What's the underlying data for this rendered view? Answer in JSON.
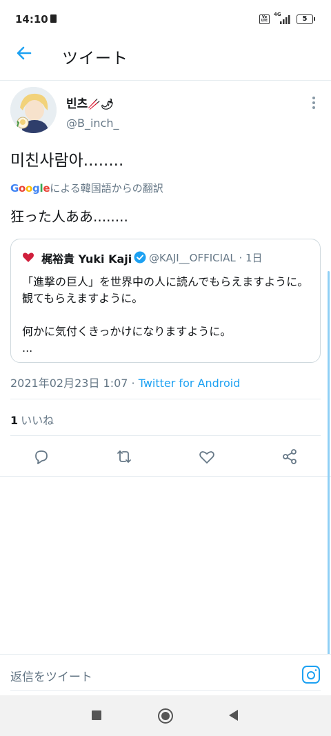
{
  "status_bar": {
    "time": "14:10",
    "volte": "Vo LTE",
    "network": "4G",
    "battery": "5"
  },
  "header": {
    "title": "ツイート",
    "back_icon": "arrow-left-icon"
  },
  "tweet": {
    "display_name": "빈츠",
    "name_emoji": "🥢🌶",
    "handle": "@B_inch_",
    "text": "미친사람아........",
    "translation_brand": "Google",
    "translation_label": "による韓国語からの翻訳",
    "translated_text": "狂った人ああ........",
    "date": "2021年02月23日 1:07 · ",
    "source": "Twitter for Android"
  },
  "quote": {
    "name": "梶裕貴 Yuki Kaji",
    "handle_time": "@KAJI__OFFICIAL · 1日",
    "text": "「進撃の巨人」を世界中の人に読んでもらえますように。観てもらえますように。\n\n何かに気付くきっかけになりますように。\n...",
    "avatar_icon": "heart-icon"
  },
  "likes": {
    "count": "1",
    "label": "いいね"
  },
  "actions": [
    "reply-icon",
    "retweet-icon",
    "like-icon",
    "share-icon"
  ],
  "reply_bar": {
    "placeholder": "返信をツイート",
    "camera_icon": "camera-icon"
  },
  "colors": {
    "accent": "#1da1f2",
    "text_primary": "#14171a",
    "text_secondary": "#657786",
    "divider": "#e6ecf0"
  }
}
